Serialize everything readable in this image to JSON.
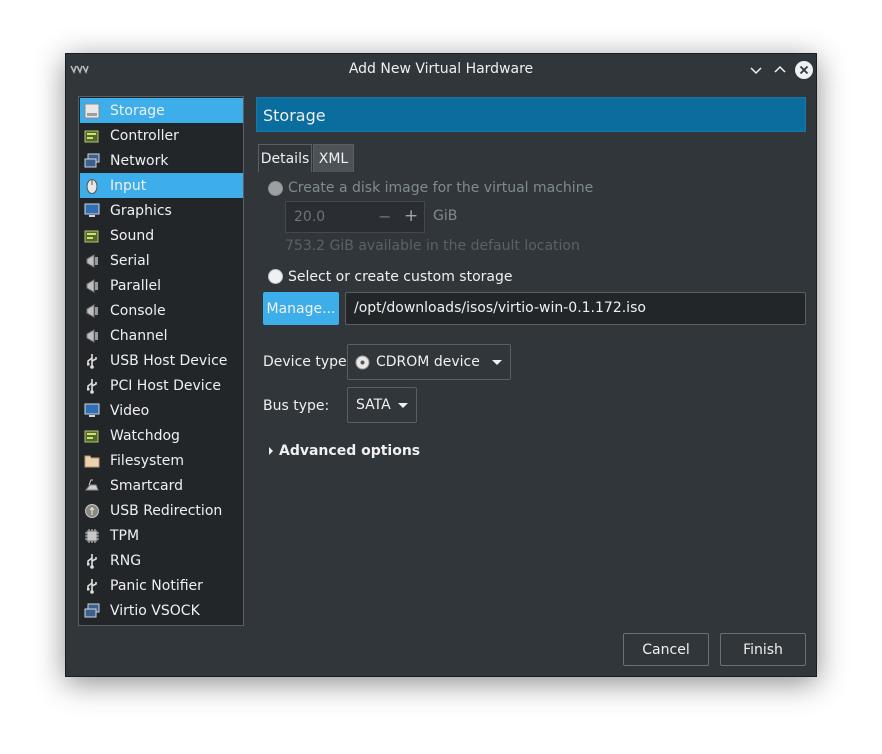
{
  "window": {
    "title": "Add New Virtual Hardware"
  },
  "sidebar": {
    "items": [
      {
        "label": "Storage",
        "icon": "storage-icon",
        "selected": true
      },
      {
        "label": "Controller",
        "icon": "controller-icon",
        "selected": false
      },
      {
        "label": "Network",
        "icon": "network-icon",
        "selected": false
      },
      {
        "label": "Input",
        "icon": "mouse-icon",
        "selected": true
      },
      {
        "label": "Graphics",
        "icon": "monitor-icon",
        "selected": false
      },
      {
        "label": "Sound",
        "icon": "sound-card-icon",
        "selected": false
      },
      {
        "label": "Serial",
        "icon": "serial-port-icon",
        "selected": false
      },
      {
        "label": "Parallel",
        "icon": "parallel-port-icon",
        "selected": false
      },
      {
        "label": "Console",
        "icon": "console-icon",
        "selected": false
      },
      {
        "label": "Channel",
        "icon": "channel-icon",
        "selected": false
      },
      {
        "label": "USB Host Device",
        "icon": "usb-icon",
        "selected": false
      },
      {
        "label": "PCI Host Device",
        "icon": "pci-icon",
        "selected": false
      },
      {
        "label": "Video",
        "icon": "video-icon",
        "selected": false
      },
      {
        "label": "Watchdog",
        "icon": "watchdog-icon",
        "selected": false
      },
      {
        "label": "Filesystem",
        "icon": "folder-icon",
        "selected": false
      },
      {
        "label": "Smartcard",
        "icon": "smartcard-icon",
        "selected": false
      },
      {
        "label": "USB Redirection",
        "icon": "usb-redirection-icon",
        "selected": false
      },
      {
        "label": "TPM",
        "icon": "tpm-chip-icon",
        "selected": false
      },
      {
        "label": "RNG",
        "icon": "rng-icon",
        "selected": false
      },
      {
        "label": "Panic Notifier",
        "icon": "panic-notifier-icon",
        "selected": false
      },
      {
        "label": "Virtio VSOCK",
        "icon": "vsock-icon",
        "selected": false
      }
    ]
  },
  "main": {
    "header": "Storage",
    "tabs": [
      {
        "label": "Details",
        "active": true
      },
      {
        "label": "XML",
        "active": false
      }
    ],
    "create_disk": {
      "label": "Create a disk image for the virtual machine",
      "size_value": "20.0",
      "minus": "−",
      "plus": "+",
      "unit": "GiB",
      "available": "753.2 GiB available in the default location"
    },
    "custom_storage": {
      "label": "Select or create custom storage",
      "manage_label": "Manage...",
      "path_value": "/opt/downloads/isos/virtio-win-0.1.172.iso"
    },
    "device_type": {
      "label": "Device type:",
      "value": "CDROM device",
      "icon": "cdrom-icon"
    },
    "bus_type": {
      "label": "Bus type:",
      "value": "SATA"
    },
    "advanced_label": "Advanced options"
  },
  "footer": {
    "cancel_label": "Cancel",
    "finish_label": "Finish"
  },
  "colors": {
    "window_bg": "#31363b",
    "accent": "#3daee9",
    "header_bg": "#0a6d9d",
    "list_bg": "#232629"
  }
}
